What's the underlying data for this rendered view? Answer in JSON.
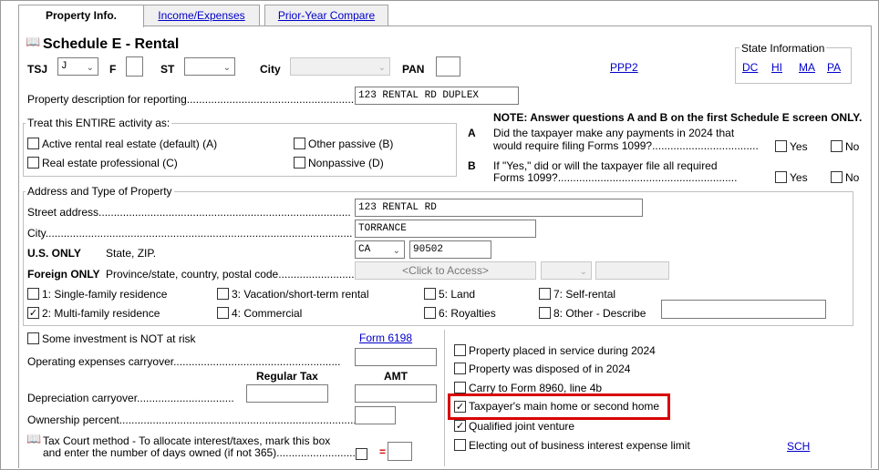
{
  "tabs": [
    {
      "label": "Property Info.",
      "active": true
    },
    {
      "label": "Income/Expenses",
      "active": false
    },
    {
      "label": "Prior-Year Compare",
      "active": false
    }
  ],
  "header": {
    "title": "Schedule E - Rental",
    "tsj_label": "TSJ",
    "tsj_value": "J",
    "f_label": "F",
    "st_label": "ST",
    "city_label": "City",
    "pan_label": "PAN",
    "ppp2_link": "PPP2"
  },
  "state_info": {
    "title": "State Information",
    "states": [
      "DC",
      "HI",
      "MA",
      "PA"
    ]
  },
  "property_description": {
    "label": "Property description for reporting.......................................................",
    "value": "123 RENTAL RD DUPLEX"
  },
  "treat_activity": {
    "title": "Treat this ENTIRE activity as:",
    "options": [
      {
        "label": "Active rental real estate (default) (A)",
        "checked": false
      },
      {
        "label": "Real estate professional (C)",
        "checked": false
      },
      {
        "label": "Other passive (B)",
        "checked": false
      },
      {
        "label": "Nonpassive (D)",
        "checked": false
      }
    ]
  },
  "questions": {
    "note": "NOTE: Answer questions A and B on the first Schedule E screen ONLY.",
    "a_letter": "A",
    "a_text_1": "Did the taxpayer make any payments in 2024 that",
    "a_text_2": "would require filing Forms 1099?...................................",
    "b_letter": "B",
    "b_text_1": "If \"Yes,\" did or will the taxpayer file all required",
    "b_text_2": "Forms 1099?...........................................................",
    "yes": "Yes",
    "no": "No"
  },
  "address": {
    "title": "Address and Type of Property",
    "street_label": "Street address...................................................................................",
    "street_value": "123 RENTAL RD",
    "city_label": "City.....................................................................................................",
    "city_value": "TORRANCE",
    "us_only": "U.S. ONLY",
    "state_zip_label": "State, ZIP.",
    "state_value": "CA",
    "zip_value": "90502",
    "foreign_only": "Foreign ONLY",
    "foreign_label": "Province/state, country, postal code................................",
    "click_to_access": "<Click to Access>"
  },
  "property_types": [
    {
      "label": "1: Single-family residence",
      "checked": false
    },
    {
      "label": "2: Multi-family residence",
      "checked": true
    },
    {
      "label": "3: Vacation/short-term rental",
      "checked": false
    },
    {
      "label": "4: Commercial",
      "checked": false
    },
    {
      "label": "5: Land",
      "checked": false
    },
    {
      "label": "6: Royalties",
      "checked": false
    },
    {
      "label": "7: Self-rental",
      "checked": false
    },
    {
      "label": "8: Other - Describe",
      "checked": false
    }
  ],
  "lower_left": {
    "not_at_risk": "Some investment is NOT at risk",
    "form6198": "Form 6198",
    "op_expenses": "Operating expenses carryover.......................................................",
    "regular_tax": "Regular Tax",
    "amt": "AMT",
    "depreciation": "Depreciation carryover................................",
    "ownership": "Ownership percent...............................................................................",
    "tax_court_1": "Tax Court method - To allocate interest/taxes, mark this box",
    "tax_court_2": "and enter the number of days owned (if not 365).............................",
    "equals": "="
  },
  "lower_right": {
    "options": [
      {
        "label": "Property placed in service during 2024",
        "checked": false
      },
      {
        "label": "Property was disposed of in 2024",
        "checked": false
      },
      {
        "label": "Carry to Form 8960, line 4b",
        "checked": false
      },
      {
        "label": "Taxpayer's main home or second home",
        "checked": true
      },
      {
        "label": "Qualified joint venture",
        "checked": true
      },
      {
        "label": "Electing out of business interest expense limit",
        "checked": false
      }
    ],
    "sch_link": "SCH"
  },
  "colors": {
    "link": "#0000cc",
    "highlight": "#d80000"
  }
}
